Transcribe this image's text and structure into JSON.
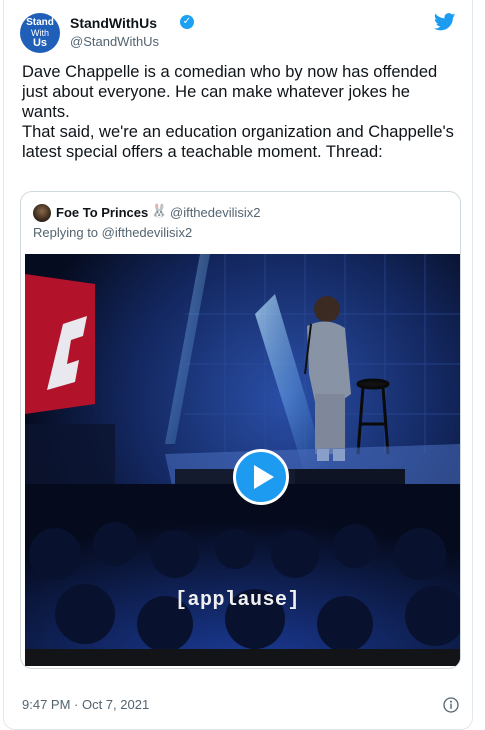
{
  "author": {
    "name": "StandWithUs",
    "handle": "@StandWithUs",
    "avatar_text": [
      "Stand",
      "With",
      "Us"
    ]
  },
  "tweet_text": "Dave Chappelle is a comedian who by now has offended just about everyone. He can make whatever jokes he wants.\nThat said, we're an education organization and Chappelle's latest special offers a teachable moment. Thread:",
  "quoted": {
    "name": "Foe To Princes",
    "emoji": "🐰",
    "handle": "@ifthedevilisix2",
    "reply_prefix": "Replying to ",
    "reply_handle": "@ifthedevilisix2",
    "video_caption": "[applause]"
  },
  "timestamp": "9:47 PM · Oct 7, 2021",
  "colors": {
    "twitter_blue": "#1d9bf0",
    "text": "#0f1419",
    "secondary": "#536471",
    "border": "#cfd9de"
  },
  "icons": [
    "verified-badge-icon",
    "twitter-bird-icon",
    "play-icon",
    "info-icon"
  ]
}
